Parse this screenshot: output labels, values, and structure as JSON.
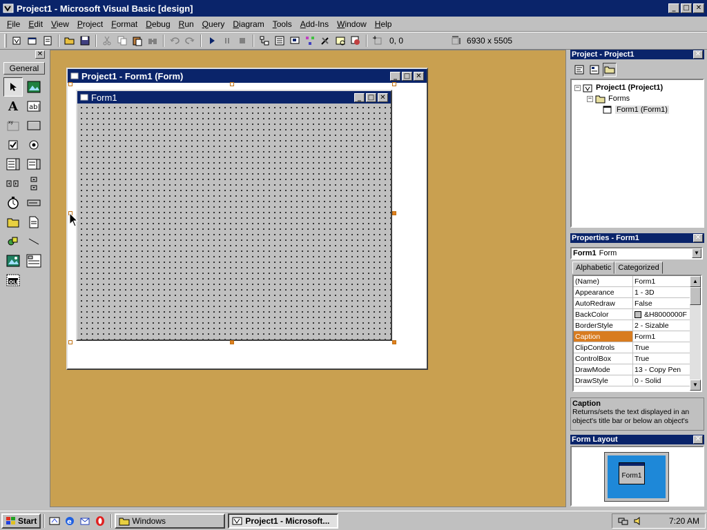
{
  "title_bar": {
    "title": "Project1 - Microsoft Visual Basic [design]"
  },
  "menu": {
    "items": [
      "File",
      "Edit",
      "View",
      "Project",
      "Format",
      "Debug",
      "Run",
      "Query",
      "Diagram",
      "Tools",
      "Add-Ins",
      "Window",
      "Help"
    ]
  },
  "toolbar": {
    "position": "0, 0",
    "size": "6930 x 5505"
  },
  "toolbox": {
    "tab_label": "General"
  },
  "designer": {
    "window_title": "Project1 - Form1 (Form)",
    "form_title": "Form1"
  },
  "project_panel": {
    "title": "Project - Project1",
    "tree": {
      "root": "Project1 (Project1)",
      "folder": "Forms",
      "item": "Form1 (Form1)"
    }
  },
  "properties_panel": {
    "title": "Properties - Form1",
    "object_name": "Form1",
    "object_type": "Form",
    "tabs": [
      "Alphabetic",
      "Categorized"
    ],
    "rows": [
      {
        "name": "(Name)",
        "value": "Form1"
      },
      {
        "name": "Appearance",
        "value": "1 - 3D"
      },
      {
        "name": "AutoRedraw",
        "value": "False"
      },
      {
        "name": "BackColor",
        "value": "&H8000000F"
      },
      {
        "name": "BorderStyle",
        "value": "2 - Sizable"
      },
      {
        "name": "Caption",
        "value": "Form1"
      },
      {
        "name": "ClipControls",
        "value": "True"
      },
      {
        "name": "ControlBox",
        "value": "True"
      },
      {
        "name": "DrawMode",
        "value": "13 - Copy Pen"
      },
      {
        "name": "DrawStyle",
        "value": "0 - Solid"
      }
    ],
    "description_title": "Caption",
    "description_text": "Returns/sets the text displayed in an object's title bar or below an object's"
  },
  "form_layout": {
    "title": "Form Layout",
    "mini_form_label": "Form1"
  },
  "taskbar": {
    "start_label": "Start",
    "tasks": [
      "Windows",
      "Project1 - Microsoft..."
    ],
    "clock": "7:20 AM"
  },
  "colors": {
    "titlebar": "#0a246a",
    "workspace": "#c9a050",
    "selected_property": "#d87c20",
    "monitor_screen": "#1e88d8"
  }
}
